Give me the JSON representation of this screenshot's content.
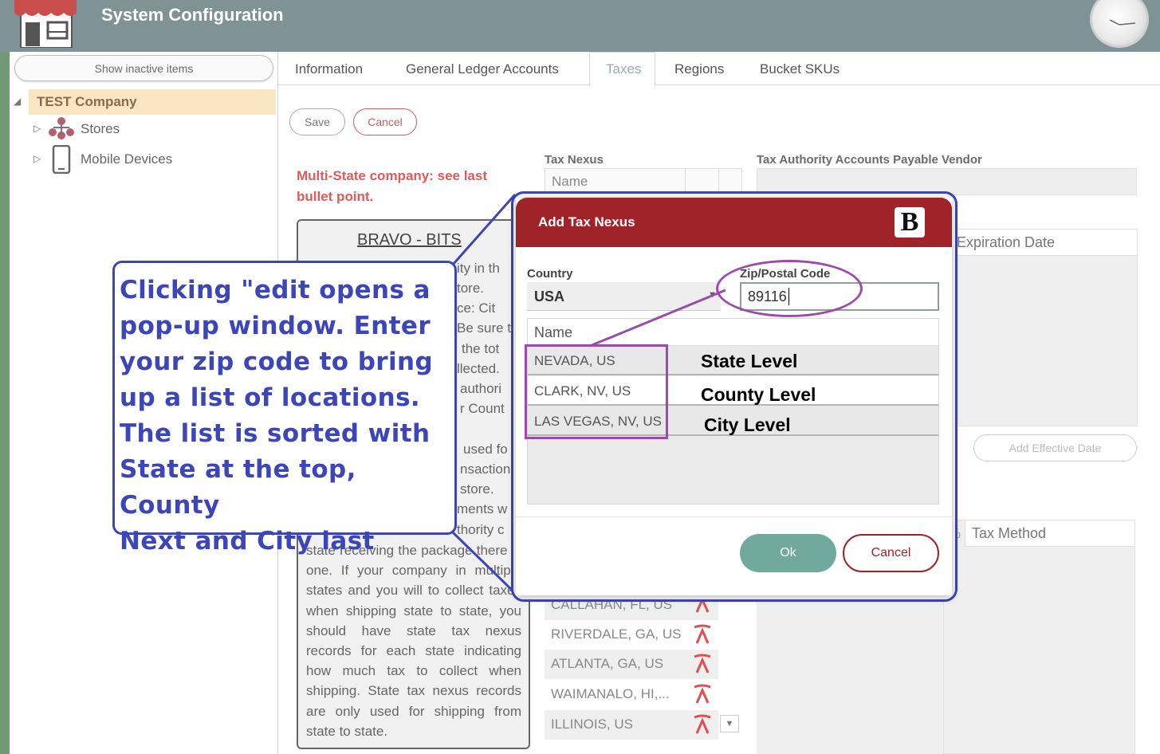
{
  "header": {
    "title": "System Configuration"
  },
  "sidebar": {
    "show_inactive": "Show inactive items",
    "tree": {
      "root": "TEST Company",
      "children": [
        {
          "label": "Stores",
          "icon": "stores-icon"
        },
        {
          "label": "Mobile Devices",
          "icon": "mobile-device-icon"
        }
      ]
    }
  },
  "tabs": [
    {
      "label": "Information",
      "active": false
    },
    {
      "label": "General Ledger Accounts",
      "active": false
    },
    {
      "label": "Taxes",
      "active": true
    },
    {
      "label": "Regions",
      "active": false
    },
    {
      "label": "Bucket SKUs",
      "active": false
    }
  ],
  "toolbar": {
    "save": "Save",
    "cancel": "Cancel"
  },
  "main": {
    "multi_state_note": "Multi-State company: see last bullet point.",
    "info_box": {
      "title": "BRAVO - BITS",
      "right_fragments": [
        "ity in th",
        "tore.",
        "ce:  Cit",
        "Be sure t",
        "the tot",
        "llected.",
        "authori",
        "r  Count",
        "used fo",
        "nsaction",
        "store.",
        "ments w",
        "thority c"
      ],
      "body": "state receiving the package there is one.  If your company in multiple states and you will to collect taxes when shipping state to state, you should have state tax nexus records for each state indicating how much tax to collect when shipping.  State tax nexus records are only used for shipping from state to state."
    },
    "tax_nexus_label": "Tax Nexus",
    "name_header": "Name",
    "vendor_label": "Tax Authority Accounts Payable Vendor",
    "expiration_header": "Expiration Date",
    "add_effective_date": "Add Effective Date",
    "tax_method_header": "Tax Method",
    "nexus_rows": [
      "CALLAHAN, FL, US",
      "RIVERDALE, GA, US",
      "ATLANTA, GA, US",
      "WAIMANALO, HI,...",
      "ILLINOIS, US"
    ]
  },
  "dialog": {
    "title": "Add Tax Nexus",
    "country_label": "Country",
    "country_value": "USA",
    "zip_label": "Zip/Postal Code",
    "zip_value": "89116",
    "results_header": "Name",
    "results": [
      {
        "name": "NEVADA, US",
        "annotation": "State Level"
      },
      {
        "name": "CLARK, NV, US",
        "annotation": "County Level"
      },
      {
        "name": "LAS VEGAS, NV, US",
        "annotation": "City Level"
      }
    ],
    "ok": "Ok",
    "cancel": "Cancel"
  },
  "callout": {
    "text_lines": [
      "Clicking \"edit opens a",
      "pop-up window. Enter",
      "your zip code to bring",
      "up a list of locations.",
      "The list is sorted with",
      "State at the top, County",
      "Next and City last"
    ]
  },
  "colors": {
    "header_bg": "#7f9295",
    "dialog_header": "#a1232a",
    "annotation_blue": "#3c46b9",
    "annotation_purple": "#9a4bab",
    "ok_button": "#71a99f",
    "warning_text": "#e05a5a"
  }
}
